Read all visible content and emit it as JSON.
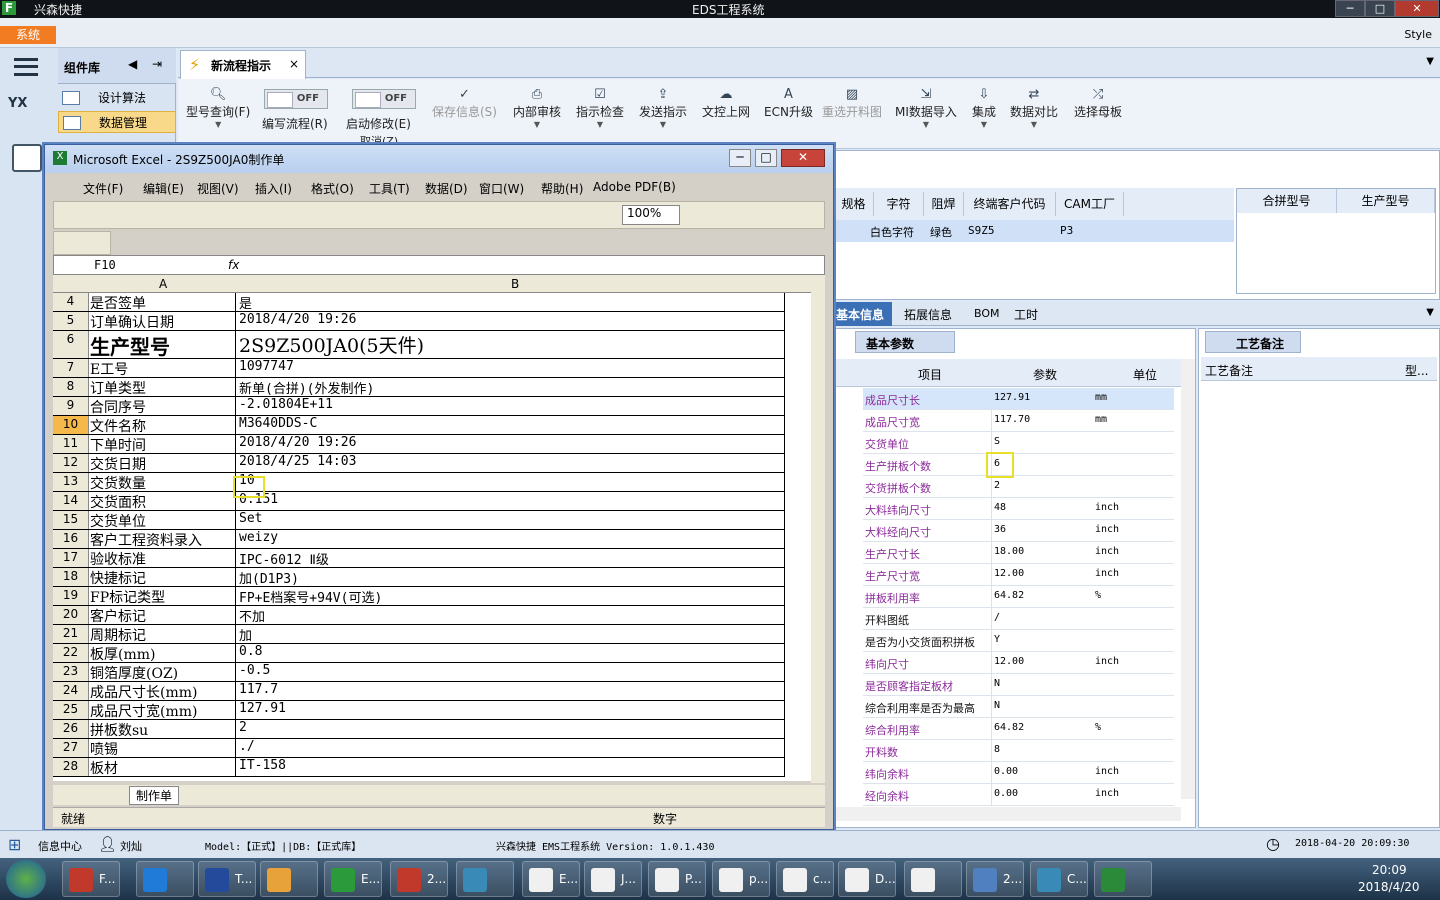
{
  "app": {
    "title": "EDS工程系统",
    "left_title": "兴森快捷",
    "system_btn": "系统",
    "style_label": "Style",
    "min": "─",
    "max": "□",
    "close": "✕"
  },
  "nav": {
    "header": "组件库",
    "items": [
      "设计算法",
      "数据管理"
    ]
  },
  "tab": {
    "label": "新流程指示",
    "close": "×"
  },
  "toolbar": {
    "items": [
      "型号查询(F)",
      "编写流程(R)",
      "启动修改(E)",
      "保存信息(S)",
      "内部审核",
      "指示检查",
      "发送指示",
      "文控上网",
      "ECN升级",
      "重选开料图",
      "MI数据导入",
      "集成",
      "数据对比",
      "选择母板"
    ],
    "toggle_off": "OFF",
    "cancel": "取消(Z)"
  },
  "order_grid": {
    "headers": [
      "规格",
      "字符",
      "阻焊",
      "终端客户代码",
      "CAM工厂"
    ],
    "row": [
      "",
      "白色字符",
      "绿色",
      "S9Z5",
      "P3"
    ],
    "right_headers": [
      "合拼型号",
      "生产型号"
    ]
  },
  "bottom_tabs": [
    "基本信息",
    "拓展信息",
    "BOM",
    "工时"
  ],
  "param_panel": {
    "title": "基本参数",
    "headers": [
      "项目",
      "参数",
      "单位"
    ],
    "rows": [
      [
        "成品尺寸长",
        "127.91",
        "mm"
      ],
      [
        "成品尺寸宽",
        "117.70",
        "mm"
      ],
      [
        "交货单位",
        "S",
        ""
      ],
      [
        "生产拼板个数",
        "6",
        ""
      ],
      [
        "交货拼板个数",
        "2",
        ""
      ],
      [
        "大料纬向尺寸",
        "48",
        "inch"
      ],
      [
        "大料经向尺寸",
        "36",
        "inch"
      ],
      [
        "生产尺寸长",
        "18.00",
        "inch"
      ],
      [
        "生产尺寸宽",
        "12.00",
        "inch"
      ],
      [
        "拼板利用率",
        "64.82",
        "%"
      ],
      [
        "开料图纸",
        "/",
        ""
      ],
      [
        "是否为小交货面积拼板",
        "Y",
        ""
      ],
      [
        "纬向尺寸",
        "12.00",
        "inch"
      ],
      [
        "是否顾客指定板材",
        "N",
        ""
      ],
      [
        "综合利用率是否为最高",
        "N",
        ""
      ],
      [
        "综合利用率",
        "64.82",
        "%"
      ],
      [
        "开料数",
        "8",
        ""
      ],
      [
        "纬向余料",
        "0.00",
        "inch"
      ],
      [
        "经向余料",
        "0.00",
        "inch"
      ]
    ]
  },
  "notes_panel": {
    "title": "工艺备注",
    "header": "工艺备注",
    "col2": "型..."
  },
  "excel": {
    "title": "Microsoft Excel - 2S9Z500JA0制作单",
    "menus": [
      "文件(F)",
      "编辑(E)",
      "视图(V)",
      "插入(I)",
      "格式(O)",
      "工具(T)",
      "数据(D)",
      "窗口(W)",
      "帮助(H)",
      "Adobe PDF(B)"
    ],
    "zoom": "100%",
    "cell_ref": "F10",
    "fx": "fx",
    "col_a": "A",
    "col_b": "B",
    "sheet_tab": "制作单",
    "status_left": "就绪",
    "status_right": "数字",
    "rows": [
      [
        "4",
        "是否签单",
        "是"
      ],
      [
        "5",
        "订单确认日期",
        "2018/4/20 19:26"
      ],
      [
        "6",
        "生产型号",
        "2S9Z500JA0(5天件)"
      ],
      [
        "7",
        "E工号",
        "1097747"
      ],
      [
        "8",
        "订单类型",
        "新单(合拼)(外发制作)"
      ],
      [
        "9",
        "合同序号",
        "-2.01804E+11"
      ],
      [
        "10",
        "文件名称",
        "M3640DDS-C"
      ],
      [
        "11",
        "下单时间",
        "2018/4/20 19:26"
      ],
      [
        "12",
        "交货日期",
        "2018/4/25 14:03"
      ],
      [
        "13",
        "交货数量",
        "10"
      ],
      [
        "14",
        "交货面积",
        "0.151"
      ],
      [
        "15",
        "交货单位",
        "Set"
      ],
      [
        "16",
        "客户工程资料录入",
        "weizy"
      ],
      [
        "17",
        "验收标准",
        "IPC-6012 Ⅱ级"
      ],
      [
        "18",
        "快捷标记",
        "加(D1P3)"
      ],
      [
        "19",
        "FP标记类型",
        "FP+E档案号+94V(可选)"
      ],
      [
        "20",
        "客户标记",
        "不加"
      ],
      [
        "21",
        "周期标记",
        "加"
      ],
      [
        "22",
        "板厚(mm)",
        "0.8"
      ],
      [
        "23",
        "铜箔厚度(OZ)",
        "-0.5"
      ],
      [
        "24",
        "成品尺寸长(mm)",
        "117.7"
      ],
      [
        "25",
        "成品尺寸宽(mm)",
        "127.91"
      ],
      [
        "26",
        "拼板数su",
        "2"
      ],
      [
        "27",
        "喷锡",
        "./"
      ],
      [
        "28",
        "板材",
        "IT-158"
      ]
    ]
  },
  "statusbar": {
    "info": "信息中心",
    "user": "刘灿",
    "model": "Model:【正式】||DB:【正式库】",
    "version": "兴森快捷 EMS工程系统 Version: 1.0.1.430",
    "datetime": "2018-04-20 20:09:30"
  },
  "taskbar": {
    "items": [
      "F...",
      "",
      "T...",
      "",
      "E...",
      "2...",
      "",
      "E...",
      "J...",
      "P...",
      "p...",
      "c...",
      "D...",
      "",
      "2...",
      "C...",
      ""
    ],
    "time": "20:09",
    "date": "2018/4/20"
  }
}
